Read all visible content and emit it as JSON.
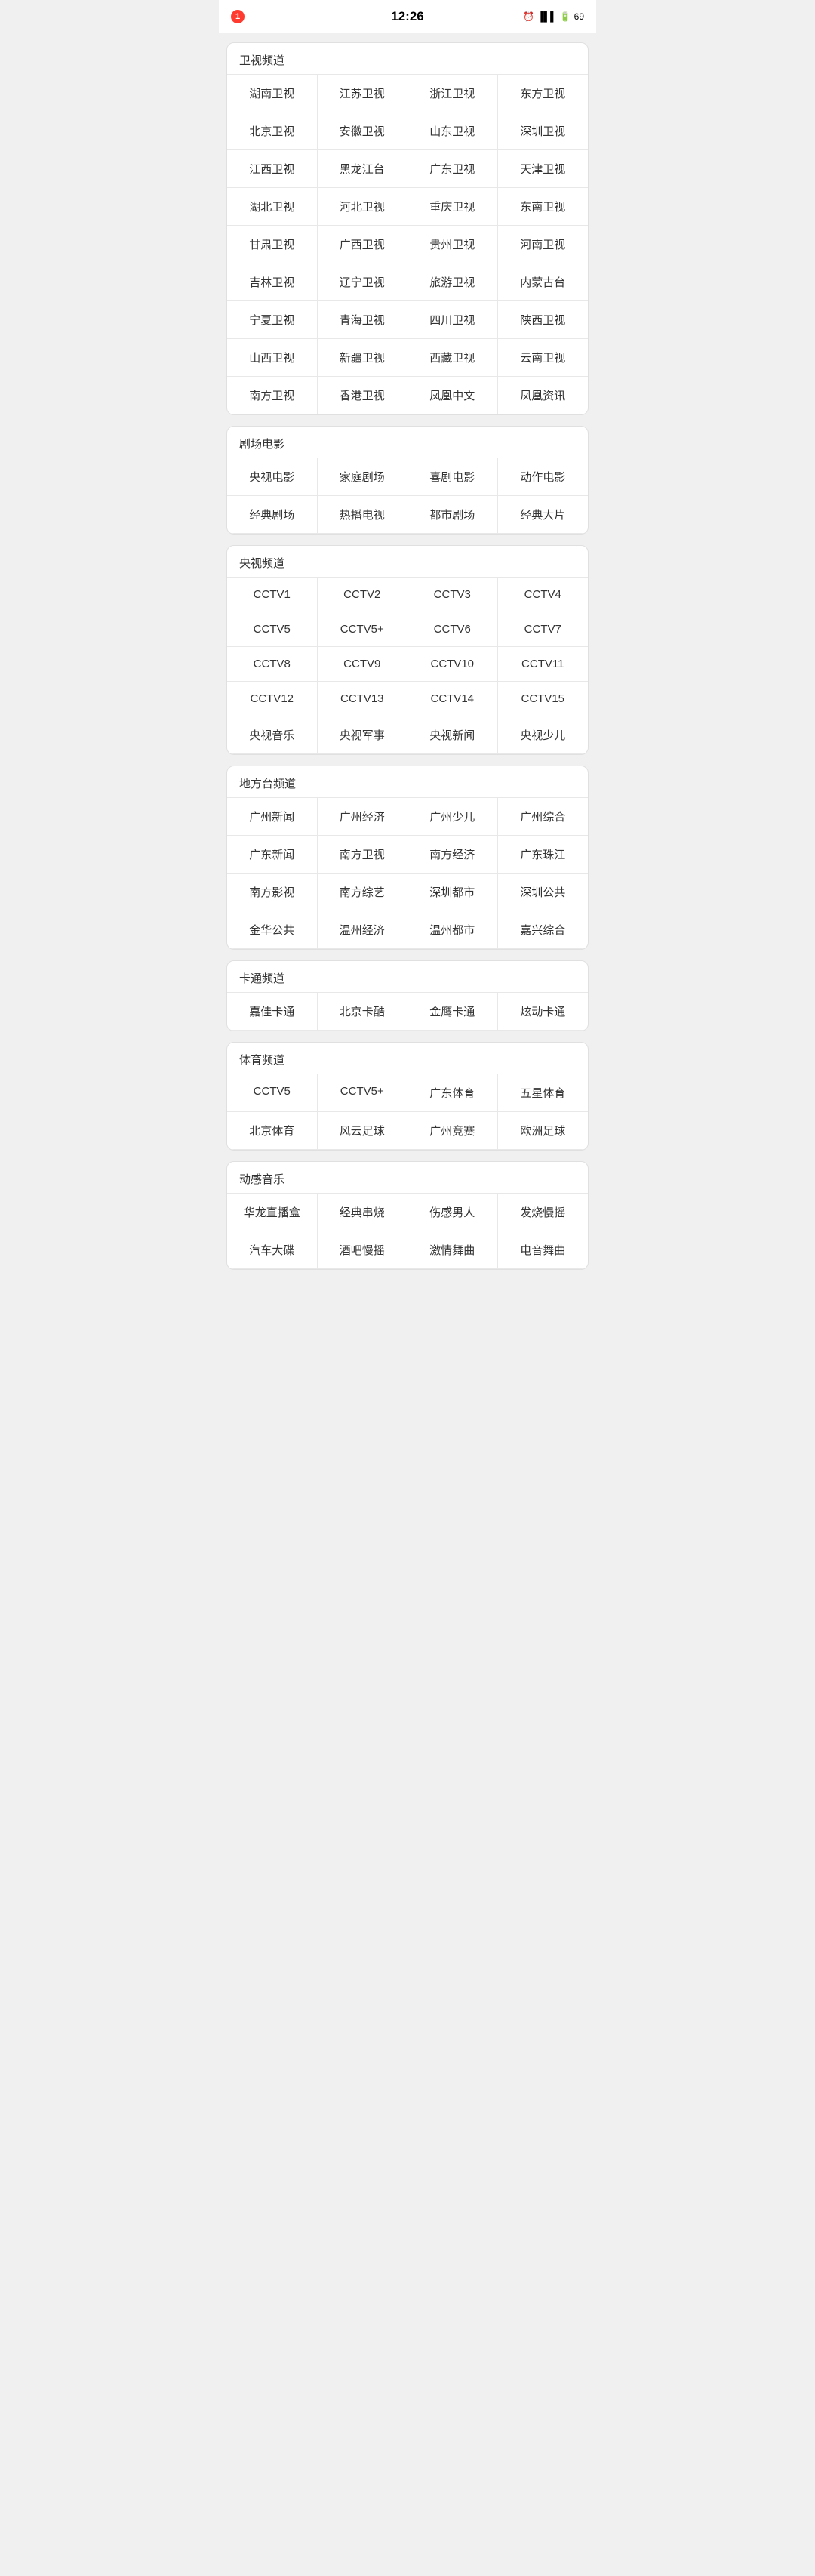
{
  "statusBar": {
    "time": "12:26",
    "notification": "1",
    "battery": "69"
  },
  "sections": [
    {
      "id": "satellite",
      "title": "卫视频道",
      "channels": [
        "湖南卫视",
        "江苏卫视",
        "浙江卫视",
        "东方卫视",
        "北京卫视",
        "安徽卫视",
        "山东卫视",
        "深圳卫视",
        "江西卫视",
        "黑龙江台",
        "广东卫视",
        "天津卫视",
        "湖北卫视",
        "河北卫视",
        "重庆卫视",
        "东南卫视",
        "甘肃卫视",
        "广西卫视",
        "贵州卫视",
        "河南卫视",
        "吉林卫视",
        "辽宁卫视",
        "旅游卫视",
        "内蒙古台",
        "宁夏卫视",
        "青海卫视",
        "四川卫视",
        "陕西卫视",
        "山西卫视",
        "新疆卫视",
        "西藏卫视",
        "云南卫视",
        "南方卫视",
        "香港卫视",
        "凤凰中文",
        "凤凰资讯"
      ]
    },
    {
      "id": "theater",
      "title": "剧场电影",
      "channels": [
        "央视电影",
        "家庭剧场",
        "喜剧电影",
        "动作电影",
        "经典剧场",
        "热播电视",
        "都市剧场",
        "经典大片"
      ]
    },
    {
      "id": "cctv",
      "title": "央视频道",
      "channels": [
        "CCTV1",
        "CCTV2",
        "CCTV3",
        "CCTV4",
        "CCTV5",
        "CCTV5+",
        "CCTV6",
        "CCTV7",
        "CCTV8",
        "CCTV9",
        "CCTV10",
        "CCTV11",
        "CCTV12",
        "CCTV13",
        "CCTV14",
        "CCTV15",
        "央视音乐",
        "央视军事",
        "央视新闻",
        "央视少儿"
      ]
    },
    {
      "id": "local",
      "title": "地方台频道",
      "channels": [
        "广州新闻",
        "广州经济",
        "广州少儿",
        "广州综合",
        "广东新闻",
        "南方卫视",
        "南方经济",
        "广东珠江",
        "南方影视",
        "南方综艺",
        "深圳都市",
        "深圳公共",
        "金华公共",
        "温州经济",
        "温州都市",
        "嘉兴综合"
      ]
    },
    {
      "id": "cartoon",
      "title": "卡通频道",
      "channels": [
        "嘉佳卡通",
        "北京卡酷",
        "金鹰卡通",
        "炫动卡通"
      ]
    },
    {
      "id": "sports",
      "title": "体育频道",
      "channels": [
        "CCTV5",
        "CCTV5+",
        "广东体育",
        "五星体育",
        "北京体育",
        "风云足球",
        "广州竞赛",
        "欧洲足球"
      ]
    },
    {
      "id": "music",
      "title": "动感音乐",
      "channels": [
        "华龙直播盒",
        "经典串烧",
        "伤感男人",
        "发烧慢摇",
        "汽车大碟",
        "酒吧慢摇",
        "激情舞曲",
        "电音舞曲"
      ]
    }
  ]
}
